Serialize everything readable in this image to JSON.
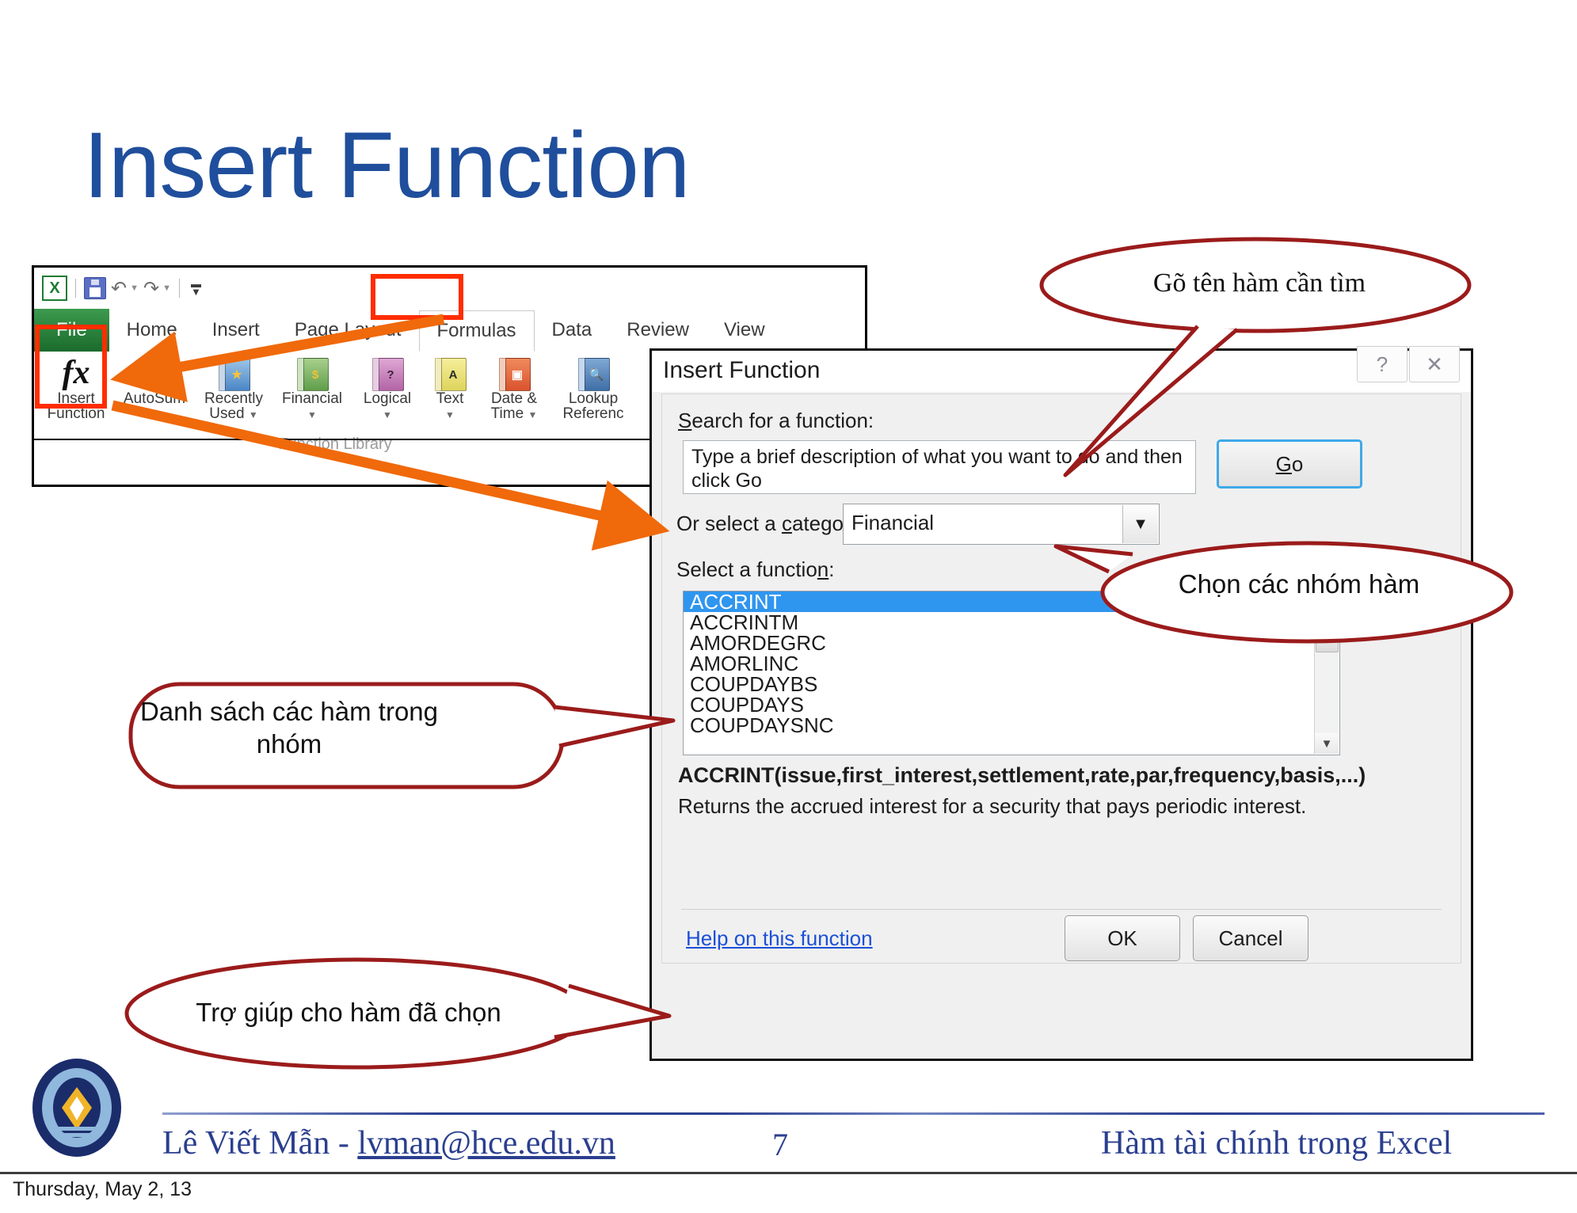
{
  "slide": {
    "title": "Insert Function",
    "date_stamp": "Thursday, May 2, 13",
    "page_number": "7"
  },
  "footer": {
    "author": "Lê Viết Mẫn - ",
    "email": "lvman@hce.edu.vn",
    "right_title": "Hàm tài chính trong Excel"
  },
  "excel": {
    "quick_access": {
      "app_icon": "excel-icon",
      "save_icon": "save-icon",
      "undo_icon": "undo-icon",
      "redo_icon": "redo-icon",
      "customize_icon": "customize-qat-icon"
    },
    "tabs": [
      {
        "label": "File",
        "state": "file"
      },
      {
        "label": "Home",
        "state": "normal"
      },
      {
        "label": "Insert",
        "state": "normal"
      },
      {
        "label": "Page Layout",
        "state": "normal"
      },
      {
        "label": "Formulas",
        "state": "active"
      },
      {
        "label": "Data",
        "state": "normal"
      },
      {
        "label": "Review",
        "state": "normal"
      },
      {
        "label": "View",
        "state": "normal"
      }
    ],
    "group_label": "Function Library",
    "ribbon_items": [
      {
        "label": "Insert\nFunction",
        "icon": "fx-icon",
        "caret": false
      },
      {
        "label": "AutoSum",
        "icon": "sigma-icon",
        "caret": true
      },
      {
        "label": "Recently\nUsed",
        "icon": "recently-used-book-icon",
        "caret": true
      },
      {
        "label": "Financial",
        "icon": "financial-book-icon",
        "caret": true
      },
      {
        "label": "Logical",
        "icon": "logical-book-icon",
        "caret": true
      },
      {
        "label": "Text",
        "icon": "text-book-icon",
        "caret": true
      },
      {
        "label": "Date &\nTime",
        "icon": "date-time-book-icon",
        "caret": true
      },
      {
        "label": "Lookup &\nReference",
        "icon": "lookup-reference-book-icon",
        "caret": true
      }
    ]
  },
  "dialog": {
    "title": "Insert Function",
    "help_button": "?",
    "close_button": "✕",
    "search_label": "Search for a function:",
    "search_value": "Type a brief description of what you want to do and then click Go",
    "go_button": "Go",
    "category_label": "Or select a category:",
    "category_value": "Financial",
    "dropdown_icon": "chevron-down-icon",
    "function_list_label": "Select a function:",
    "functions": [
      "ACCRINT",
      "ACCRINTM",
      "AMORDEGRC",
      "AMORLINC",
      "COUPDAYBS",
      "COUPDAYS",
      "COUPDAYSNC"
    ],
    "selected_function": "ACCRINT",
    "function_signature": "ACCRINT(issue,first_interest,settlement,rate,par,frequency,basis,...)",
    "function_description": "Returns the accrued interest for a security that pays periodic interest.",
    "help_link": "Help on this function",
    "ok_button": "OK",
    "cancel_button": "Cancel"
  },
  "annotations": {
    "type_name": "Gõ tên hàm cần tìm",
    "choose_category": "Chọn các nhóm hàm",
    "function_list": "Danh sách các hàm trong nhóm",
    "help_for_function": "Trợ giúp cho hàm đã chọn"
  },
  "colors": {
    "title_blue": "#1F4E9C",
    "highlight_red": "#FF2D00",
    "arrow_orange": "#F0690A",
    "callout_maroon": "#9B1B1B",
    "selection_blue": "#2F96EF",
    "link_blue": "#1B4FD8",
    "footer_blue": "#2B3F8F"
  }
}
